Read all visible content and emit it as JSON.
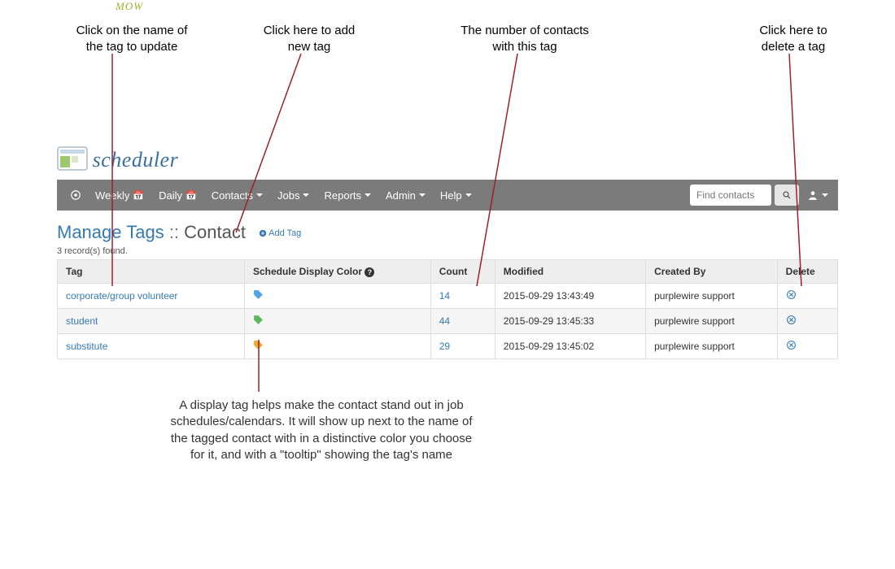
{
  "annotations": {
    "update": "Click on the name of\nthe tag to update",
    "add": "Click here to add\nnew tag",
    "count": "The number of contacts\nwith this tag",
    "delete": "Click here to\ndelete a tag",
    "display": "A display tag helps make the contact stand out in job schedules/calendars. It will show up next to the name of the tagged contact with in a distinctive color you choose for it, and with a \"tooltip\" showing the tag's name"
  },
  "logo": {
    "mow": "MOW",
    "text": "scheduler"
  },
  "nav": {
    "weekly": "Weekly",
    "daily": "Daily",
    "contacts": "Contacts",
    "jobs": "Jobs",
    "reports": "Reports",
    "admin": "Admin",
    "help": "Help",
    "search_placeholder": "Find contacts"
  },
  "title": {
    "a": "Manage Tags",
    "sep": " :: ",
    "b": "Contact",
    "add": "Add Tag"
  },
  "records": "3 record(s) found.",
  "headers": {
    "tag": "Tag",
    "color": "Schedule Display Color",
    "count": "Count",
    "modified": "Modified",
    "created": "Created By",
    "delete": "Delete"
  },
  "rows": [
    {
      "name": "corporate/group volunteer",
      "color": "#4ea3e2",
      "count": "14",
      "modified": "2015-09-29 13:43:49",
      "created": "purplewire support"
    },
    {
      "name": "student",
      "color": "#5cb85c",
      "count": "44",
      "modified": "2015-09-29 13:45:33",
      "created": "purplewire support"
    },
    {
      "name": "substitute",
      "color": "#f0a830",
      "count": "29",
      "modified": "2015-09-29 13:45:02",
      "created": "purplewire support"
    }
  ]
}
